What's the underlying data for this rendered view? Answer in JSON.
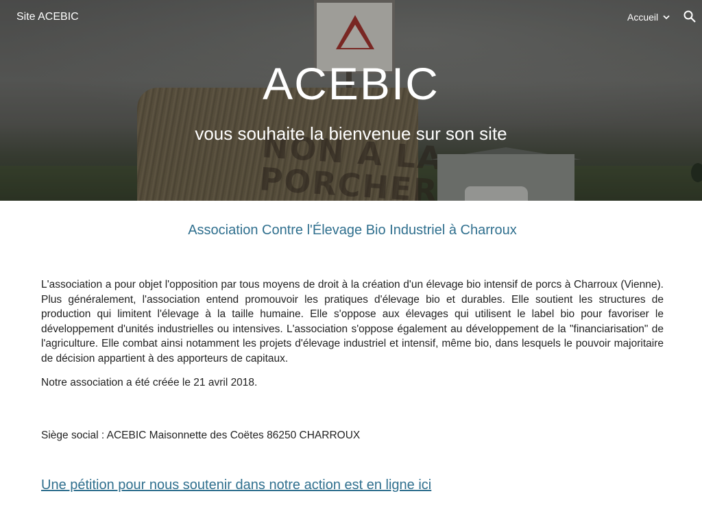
{
  "header": {
    "site_title": "Site ACEBIC",
    "nav_label": "Accueil",
    "nav_icon": "chevron-down-icon",
    "search_icon": "search-icon"
  },
  "hero": {
    "title": "ACEBIC",
    "subtitle": "vous souhaite la bienvenue sur son site",
    "bale_text_line1": "NON À LA",
    "bale_text_line2": "PORCHERIE"
  },
  "main": {
    "org_name": "Association Contre l'Élevage Bio Industriel à Charroux",
    "paragraph1": "L'association a pour objet l'opposition par tous moyens de droit à la création d'un élevage bio intensif de porcs à Charroux (Vienne). Plus généralement, l'association entend promouvoir les pratiques d'élevage bio et durables. Elle soutient les structures de production qui limitent l'élevage à la taille humaine. Elle s'oppose aux élevages qui utilisent le label bio pour favoriser le développement d'unités industrielles ou intensives. L'association s'oppose également au développement de la \"financiarisation\" de l'agriculture. Elle combat ainsi notamment les projets d'élevage industriel et intensif, même bio, dans lesquels le pouvoir majoritaire de décision appartient à des apporteurs de capitaux.",
    "paragraph2": "Notre association a été créée le 21 avril 2018.",
    "paragraph3": "Siège social : ACEBIC Maisonnette des Coëtes  86250 CHARROUX",
    "petition_link": "Une pétition pour nous soutenir dans notre action est en ligne ici"
  },
  "colors": {
    "accent": "#2f6f8e",
    "text": "#212121",
    "hero_text": "#ffffff"
  }
}
